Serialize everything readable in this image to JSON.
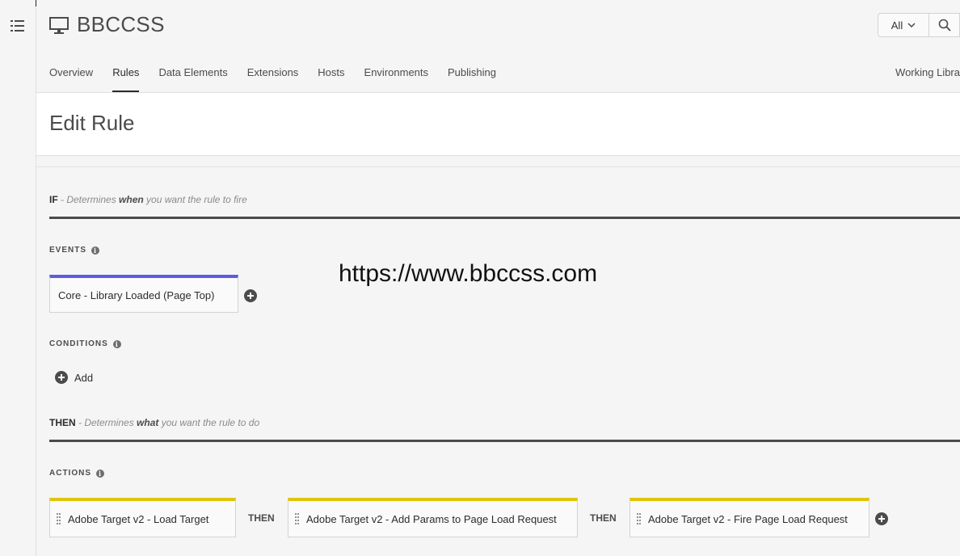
{
  "property": {
    "name": "BBCCSS"
  },
  "search": {
    "scope": "All"
  },
  "tabs": [
    {
      "label": "Overview"
    },
    {
      "label": "Rules"
    },
    {
      "label": "Data Elements"
    },
    {
      "label": "Extensions"
    },
    {
      "label": "Hosts"
    },
    {
      "label": "Environments"
    },
    {
      "label": "Publishing"
    }
  ],
  "working_library": "Working Libra",
  "page": {
    "title": "Edit Rule"
  },
  "if_section": {
    "keyword": "IF",
    "desc_pre": " - Determines ",
    "desc_bold": "when",
    "desc_post": " you want the rule to fire"
  },
  "events": {
    "label": "EVENTS",
    "items": [
      {
        "label": "Core - Library Loaded (Page Top)"
      }
    ]
  },
  "conditions": {
    "label": "CONDITIONS",
    "add_label": "Add"
  },
  "then_section": {
    "keyword": "THEN",
    "desc_pre": " - Determines ",
    "desc_bold": "what",
    "desc_post": " you want the rule to do"
  },
  "actions": {
    "label": "ACTIONS",
    "connector": "THEN",
    "items": [
      {
        "label": "Adobe Target v2 - Load Target"
      },
      {
        "label": "Adobe Target v2 - Add Params to Page Load Request"
      },
      {
        "label": "Adobe Target v2 - Fire Page Load Request"
      }
    ]
  },
  "watermark": "https://www.bbccss.com",
  "colors": {
    "event_accent": "#5c5ce0",
    "action_accent": "#e0c40c",
    "rule_line": "#4b4b4b"
  }
}
